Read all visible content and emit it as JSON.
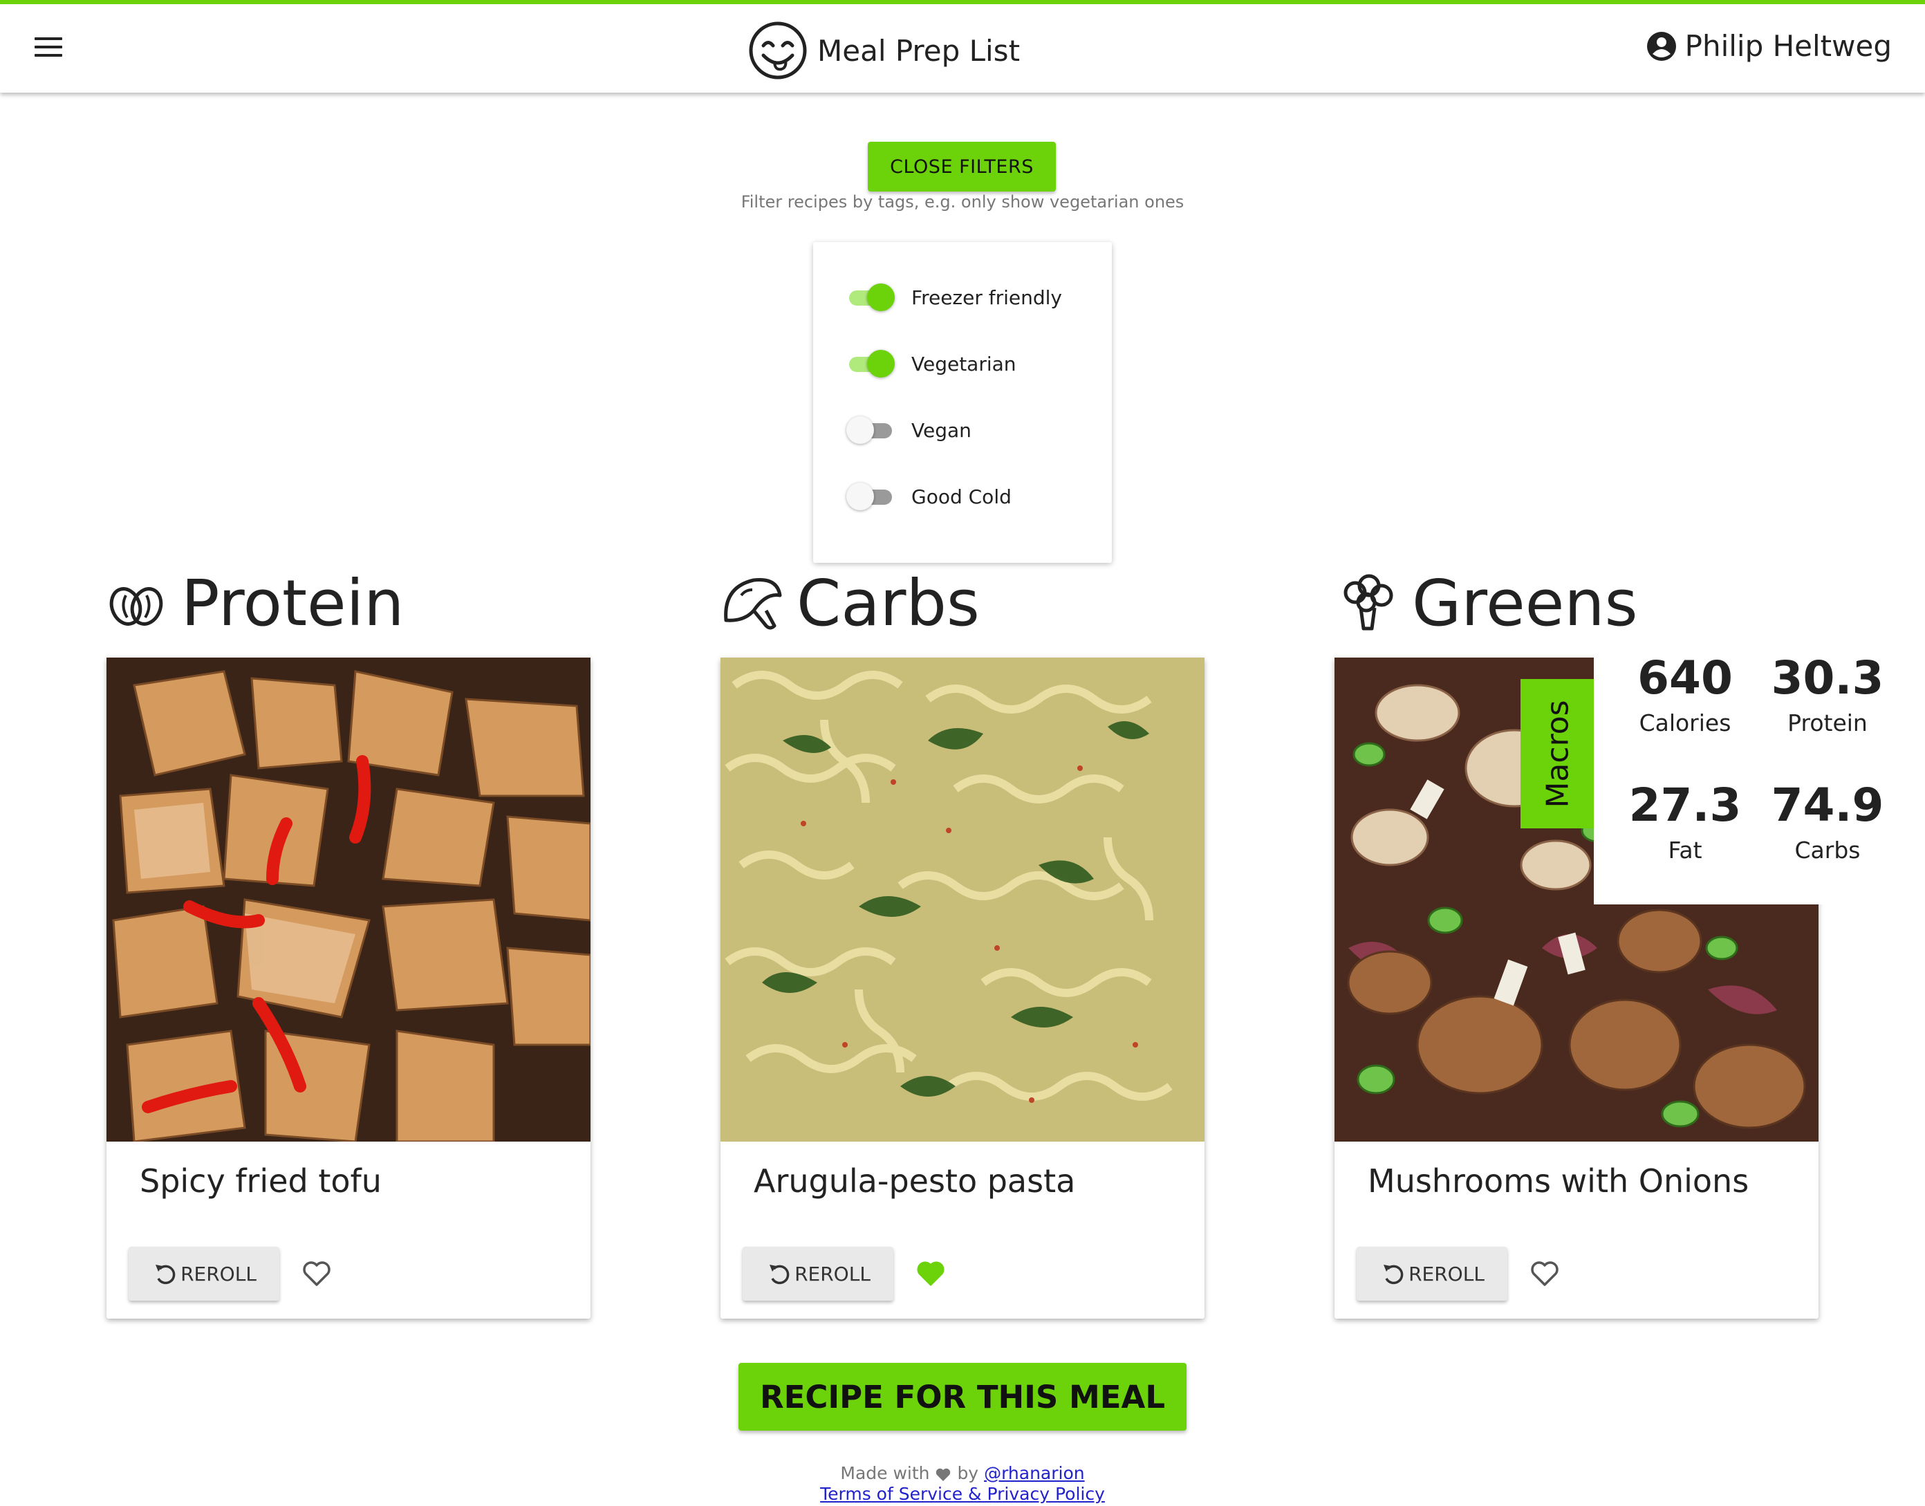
{
  "app": {
    "title": "Meal Prep List",
    "user_name": "Philip Heltweg",
    "accent_color": "#6cd20a"
  },
  "filters": {
    "close_label": "CLOSE FILTERS",
    "hint": "Filter recipes by tags, e.g. only show vegetarian ones",
    "tags": [
      {
        "label": "Freezer friendly",
        "enabled": true
      },
      {
        "label": "Vegetarian",
        "enabled": true
      },
      {
        "label": "Vegan",
        "enabled": false
      },
      {
        "label": "Good Cold",
        "enabled": false
      }
    ]
  },
  "columns": [
    {
      "title": "Protein",
      "icon": "beans-icon",
      "recipe": "Spicy fried tofu",
      "favorite": false,
      "reroll_label": "REROLL"
    },
    {
      "title": "Carbs",
      "icon": "mushroom-icon",
      "recipe": "Arugula-pesto pasta",
      "favorite": true,
      "reroll_label": "REROLL"
    },
    {
      "title": "Greens",
      "icon": "broccoli-icon",
      "recipe": "Mushrooms with Onions",
      "favorite": false,
      "reroll_label": "REROLL"
    }
  ],
  "macros": {
    "tab_label": "Macros",
    "calories": {
      "value": "640",
      "label": "Calories"
    },
    "protein": {
      "value": "30.3",
      "label": "Protein"
    },
    "fat": {
      "value": "27.3",
      "label": "Fat"
    },
    "carbs": {
      "value": "74.9",
      "label": "Carbs"
    }
  },
  "recipe_button_label": "RECIPE FOR THIS MEAL",
  "footer": {
    "made_with": "Made with",
    "by": "by",
    "author_link": "@rhanarion",
    "terms_link": "Terms of Service & Privacy Policy"
  }
}
